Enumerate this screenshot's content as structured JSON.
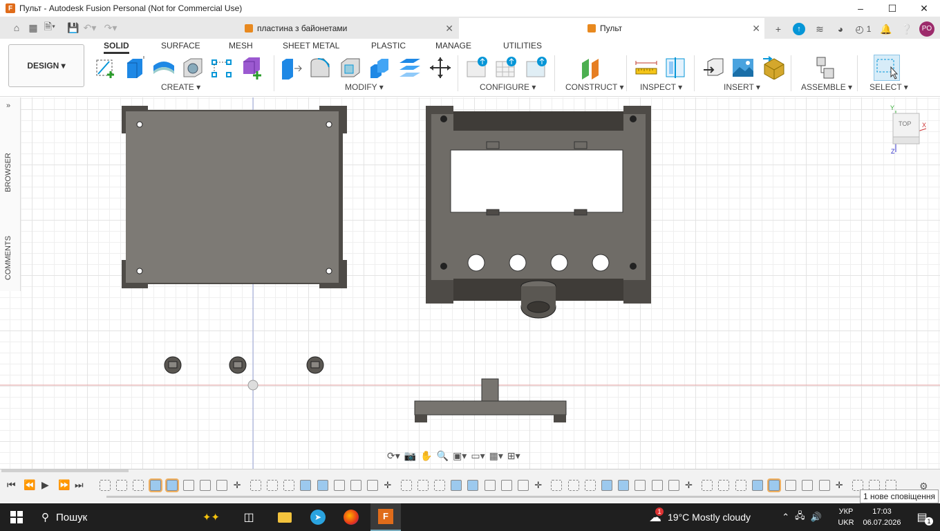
{
  "window": {
    "title": "Пульт - Autodesk Fusion Personal (Not for Commercial Use)",
    "logo": "F"
  },
  "tabs": [
    {
      "label": "пластина з байонетами",
      "active": false
    },
    {
      "label": "Пульт",
      "active": true
    }
  ],
  "header_right": {
    "job_count": "1",
    "avatar": "PO"
  },
  "ribbon": {
    "workspace": "DESIGN",
    "tabs": [
      "SOLID",
      "SURFACE",
      "MESH",
      "SHEET METAL",
      "PLASTIC",
      "MANAGE",
      "UTILITIES"
    ],
    "groups": [
      "CREATE",
      "MODIFY",
      "CONFIGURE",
      "CONSTRUCT",
      "INSPECT",
      "INSERT",
      "ASSEMBLE",
      "SELECT"
    ]
  },
  "sidebar": {
    "browser": "BROWSER",
    "comments": "COMMENTS"
  },
  "viewcube": {
    "face": "TOP",
    "axis_x": "X",
    "axis_y": "Y",
    "axis_z": "Z"
  },
  "notification": {
    "text": "1 нове сповіщення"
  },
  "taskbar": {
    "search_placeholder": "Пошук",
    "weather": "19°C  Mostly cloudy",
    "weather_badge": "1",
    "lang_top": "УКР",
    "lang_bottom": "UKR",
    "time": "17:03",
    "date": "06.07.2026",
    "notif_count": "1"
  },
  "colors": {
    "accent": "#0696d7",
    "model": "#7a7772",
    "model_dark": "#4e4b47",
    "fusion": "#e06c1a"
  }
}
